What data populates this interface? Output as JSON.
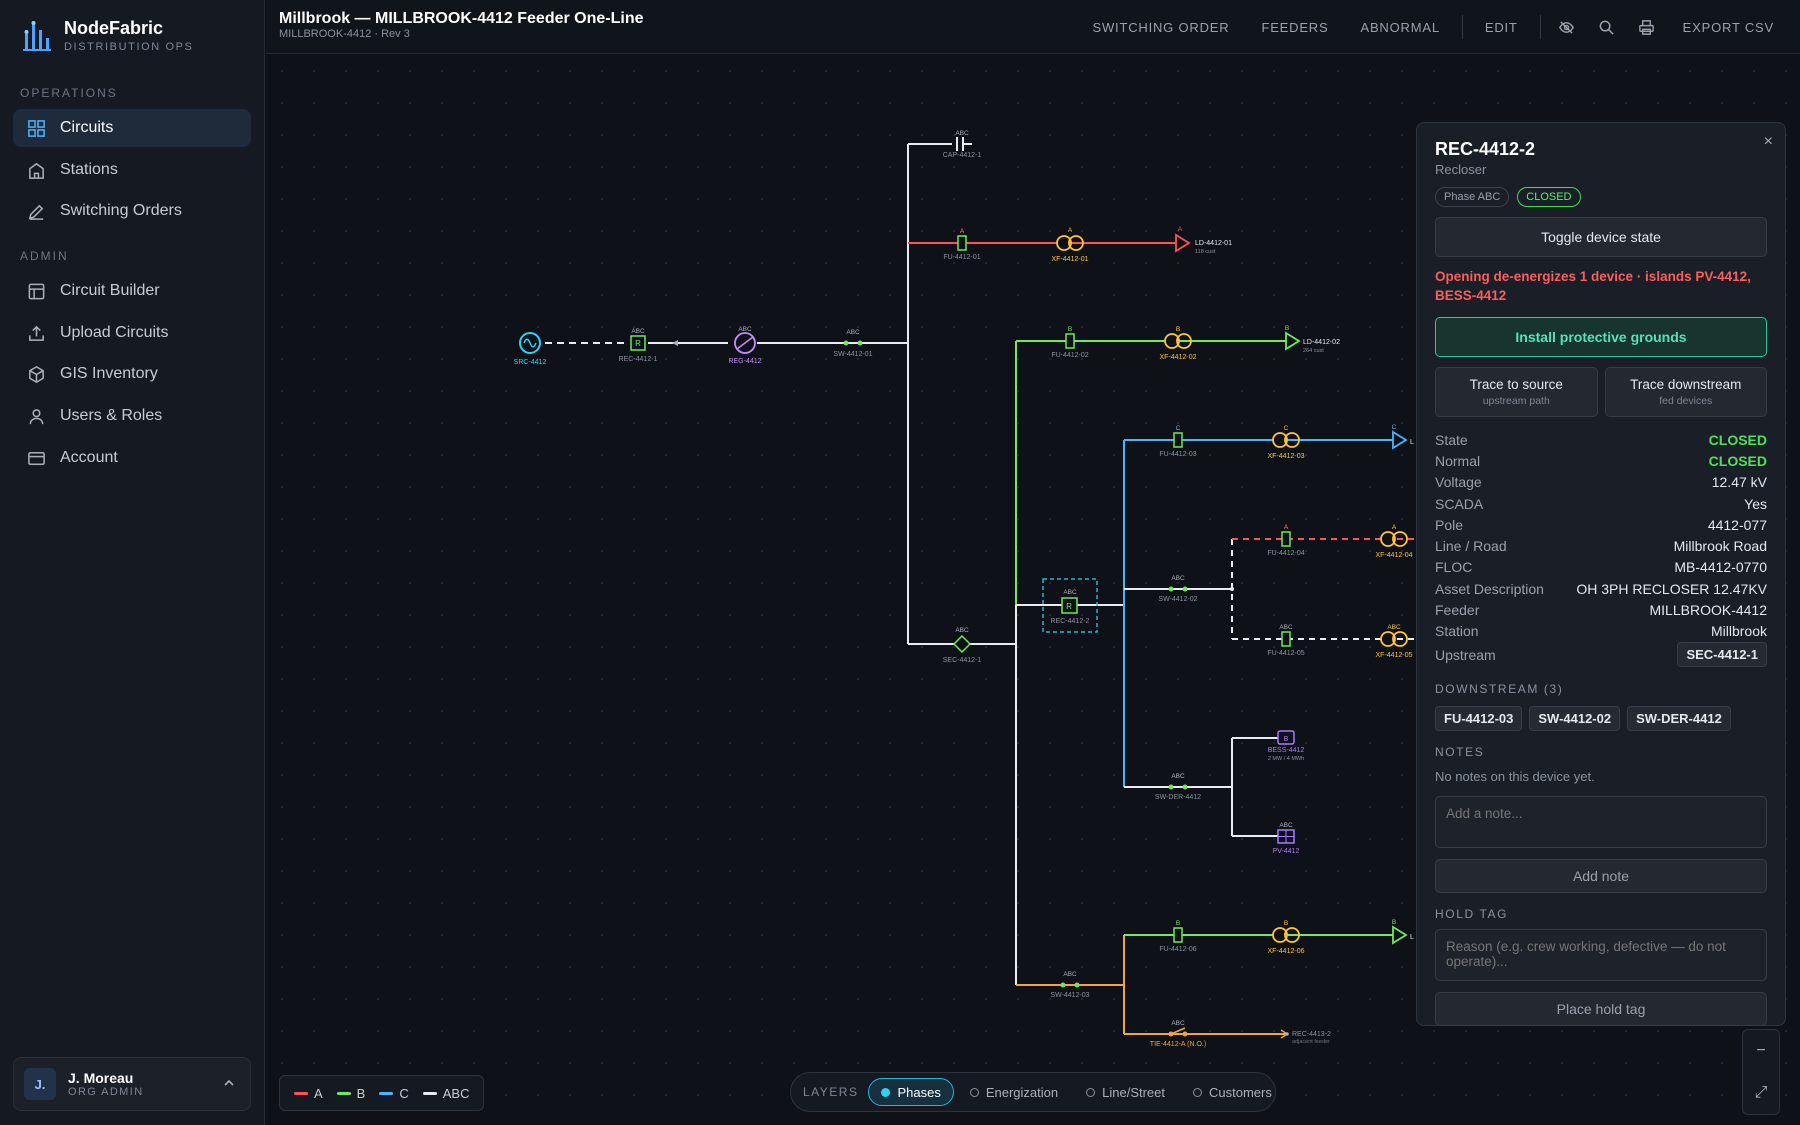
{
  "brand": {
    "name": "NodeFabric",
    "subtitle": "DISTRIBUTION OPS"
  },
  "nav": {
    "sections": [
      {
        "title": "OPERATIONS",
        "items": [
          {
            "label": "Circuits",
            "icon": "grid-icon",
            "active": true
          },
          {
            "label": "Stations",
            "icon": "building-icon"
          },
          {
            "label": "Switching Orders",
            "icon": "pen-icon"
          }
        ]
      },
      {
        "title": "ADMIN",
        "items": [
          {
            "label": "Circuit Builder",
            "icon": "layout-icon"
          },
          {
            "label": "Upload Circuits",
            "icon": "upload-icon"
          },
          {
            "label": "GIS Inventory",
            "icon": "cube-icon"
          },
          {
            "label": "Users & Roles",
            "icon": "user-icon"
          },
          {
            "label": "Account",
            "icon": "card-icon"
          }
        ]
      }
    ]
  },
  "user": {
    "initials": "J.",
    "name": "J. Moreau",
    "role": "ORG ADMIN"
  },
  "header": {
    "title": "Millbrook — MILLBROOK-4412 Feeder One-Line",
    "subtitle": "MILLBROOK-4412 · Rev 3",
    "actions": [
      "SWITCHING ORDER",
      "FEEDERS",
      "ABNORMAL",
      "EDIT",
      "EXPORT CSV"
    ]
  },
  "colors": {
    "phaseA": "#ff5252",
    "phaseB": "#72e85a",
    "phaseC": "#4db3ff",
    "abc": "#e8ebf0",
    "tie": "#f0a63a",
    "accent": "#25b4d4"
  },
  "legend": [
    {
      "label": "A",
      "color": "#ff5252"
    },
    {
      "label": "B",
      "color": "#72e85a"
    },
    {
      "label": "C",
      "color": "#4db3ff"
    },
    {
      "label": "ABC",
      "color": "#e8ebf0"
    }
  ],
  "layers": {
    "label": "LAYERS",
    "items": [
      "Phases",
      "Energization",
      "Line/Street",
      "Customers"
    ],
    "active": "Phases"
  },
  "diagram": {
    "labels": {
      "src": "SRC-4412",
      "rec1": "REC-4412-1",
      "reg": "REG-4412",
      "sw01": "SW-4412-01",
      "cap": "CAP-4412-1",
      "fu01": "FU-4412-01",
      "xf01": "XF-4412-01",
      "ld01": "LD-4412-01",
      "ld01c": "118 cust",
      "fu02": "FU-4412-02",
      "xf02": "XF-4412-02",
      "ld02": "LD-4412-02",
      "ld02c": "264 cust",
      "fu03": "FU-4412-03",
      "xf03": "XF-4412-03",
      "fu04": "FU-4412-04",
      "xf04": "XF-4412-04",
      "sw02": "SW-4412-02",
      "fu05": "FU-4412-05",
      "xf05": "XF-4412-05",
      "sec": "SEC-4412-1",
      "rec2": "REC-4412-2",
      "bess": "BESS-4412",
      "bessr": "2 MW / 4 MWh",
      "swder": "SW-DER-4412",
      "pv": "PV-4412",
      "fu06": "FU-4412-06",
      "xf06": "XF-4412-06",
      "sw03": "SW-4412-03",
      "tie": "TIE-4412-A (N.O.)",
      "rec3": "REC-4413-2",
      "rec3s": "adjacent feeder",
      "pA": "A",
      "pB": "B",
      "pC": "C",
      "pABC": "ABC",
      "pLoad": "L"
    }
  },
  "panel": {
    "title": "REC-4412-2",
    "type": "Recloser",
    "badges": [
      "Phase ABC",
      "CLOSED"
    ],
    "toggle_label": "Toggle device state",
    "warning": "Opening de-energizes 1 device · islands PV-4412, BESS-4412",
    "grounds_label": "Install protective grounds",
    "trace_source": {
      "label": "Trace to source",
      "sub": "upstream path"
    },
    "trace_down": {
      "label": "Trace downstream",
      "sub": "fed devices"
    },
    "props": [
      {
        "k": "State",
        "v": "CLOSED",
        "ok": true
      },
      {
        "k": "Normal",
        "v": "CLOSED",
        "ok": true
      },
      {
        "k": "Voltage",
        "v": "12.47 kV"
      },
      {
        "k": "SCADA",
        "v": "Yes"
      },
      {
        "k": "Pole",
        "v": "4412-077"
      },
      {
        "k": "Line / Road",
        "v": "Millbrook Road"
      },
      {
        "k": "FLOC",
        "v": "MB-4412-0770"
      },
      {
        "k": "Asset Description",
        "v": "OH 3PH RECLOSER 12.47KV"
      },
      {
        "k": "Feeder",
        "v": "MILLBROOK-4412"
      },
      {
        "k": "Station",
        "v": "Millbrook"
      }
    ],
    "upstream": {
      "k": "Upstream",
      "v": "SEC-4412-1"
    },
    "downstream_title": "DOWNSTREAM (3)",
    "downstream": [
      "FU-4412-03",
      "SW-4412-02",
      "SW-DER-4412"
    ],
    "notes_title": "NOTES",
    "notes_empty": "No notes on this device yet.",
    "note_placeholder": "Add a note...",
    "add_note_label": "Add note",
    "hold_title": "HOLD TAG",
    "hold_placeholder": "Reason (e.g. crew working, defective — do not operate)...",
    "hold_label": "Place hold tag",
    "close": "×"
  },
  "zoom": {
    "out": "−",
    "fit": "⤢"
  }
}
